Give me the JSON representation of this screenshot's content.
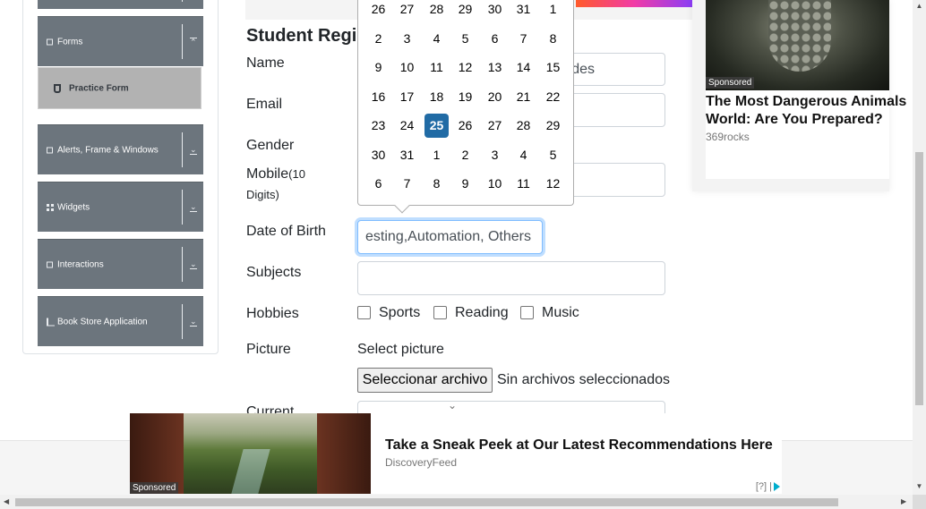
{
  "sidebar": {
    "groups": [
      {
        "label": "Forms",
        "icon": "list-icon",
        "expanded": true
      },
      {
        "label": "Alerts, Frame & Windows",
        "icon": "window-icon",
        "expanded": false
      },
      {
        "label": "Widgets",
        "icon": "grid-icon",
        "expanded": false
      },
      {
        "label": "Interactions",
        "icon": "interaction-icon",
        "expanded": false
      },
      {
        "label": "Book Store Application",
        "icon": "books-icon",
        "expanded": false
      }
    ],
    "active_item": {
      "label": "Practice Form",
      "icon": "html5-icon"
    },
    "colors": {
      "group_bg": "#6c757d",
      "active_bg": "#b2b2b2"
    }
  },
  "form": {
    "title": "Student Regis",
    "labels": {
      "name": "Name",
      "email": "Email",
      "gender": "Gender",
      "mobile": "Mobile",
      "mobile_hint": "(10",
      "mobile_hint2": "Digits)",
      "dob": "Date of Birth",
      "subjects": "Subjects",
      "hobbies": "Hobbies",
      "picture": "Picture",
      "current": "Current"
    },
    "name_last_visible": "des",
    "dob_value": "esting,Automation, Others",
    "hobbies": [
      {
        "label": "Sports",
        "checked": false
      },
      {
        "label": "Reading",
        "checked": false
      },
      {
        "label": "Music",
        "checked": false
      }
    ],
    "picture_label": "Select picture",
    "file_button": "Seleccionar archivo",
    "file_status": "Sin archivos seleccionados"
  },
  "datepicker": {
    "weeks": [
      [
        "26",
        "27",
        "28",
        "29",
        "30",
        "31",
        "1"
      ],
      [
        "2",
        "3",
        "4",
        "5",
        "6",
        "7",
        "8"
      ],
      [
        "9",
        "10",
        "11",
        "12",
        "13",
        "14",
        "15"
      ],
      [
        "16",
        "17",
        "18",
        "19",
        "20",
        "21",
        "22"
      ],
      [
        "23",
        "24",
        "25",
        "26",
        "27",
        "28",
        "29"
      ],
      [
        "30",
        "31",
        "1",
        "2",
        "3",
        "4",
        "5"
      ],
      [
        "6",
        "7",
        "8",
        "9",
        "10",
        "11",
        "12"
      ]
    ],
    "selected": "25",
    "selected_color": "#216ba5"
  },
  "ad_right": {
    "tag": "Sponsored",
    "headline": "The Most Dangerous Animals World: Are You Prepared?",
    "source": "369rocks"
  },
  "ad_bottom": {
    "tag": "Sponsored",
    "headline": "Take a Sneak Peek at Our Latest Recommendations Here",
    "source": "DiscoveryFeed",
    "info": "[?]",
    "info_separator": "|"
  }
}
